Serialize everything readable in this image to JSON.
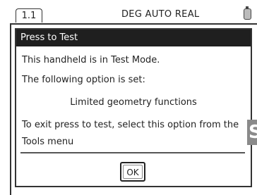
{
  "topbar": {
    "tab_label": "1.1",
    "status": "DEG AUTO REAL",
    "battery_icon": "battery-icon"
  },
  "dialog": {
    "title": "Press to Test",
    "line1": "This handheld is in Test Mode.",
    "line2": "The following option is set:",
    "option": "Limited geometry functions",
    "line4": "To exit press to test, select this option from the",
    "line5": "Tools menu",
    "ok_label": "OK"
  },
  "edge": {
    "letter": "S"
  },
  "colors": {
    "title_bg": "#1f1f1f",
    "title_fg": "#ffffff",
    "edge_bg": "#8a8a8a"
  }
}
